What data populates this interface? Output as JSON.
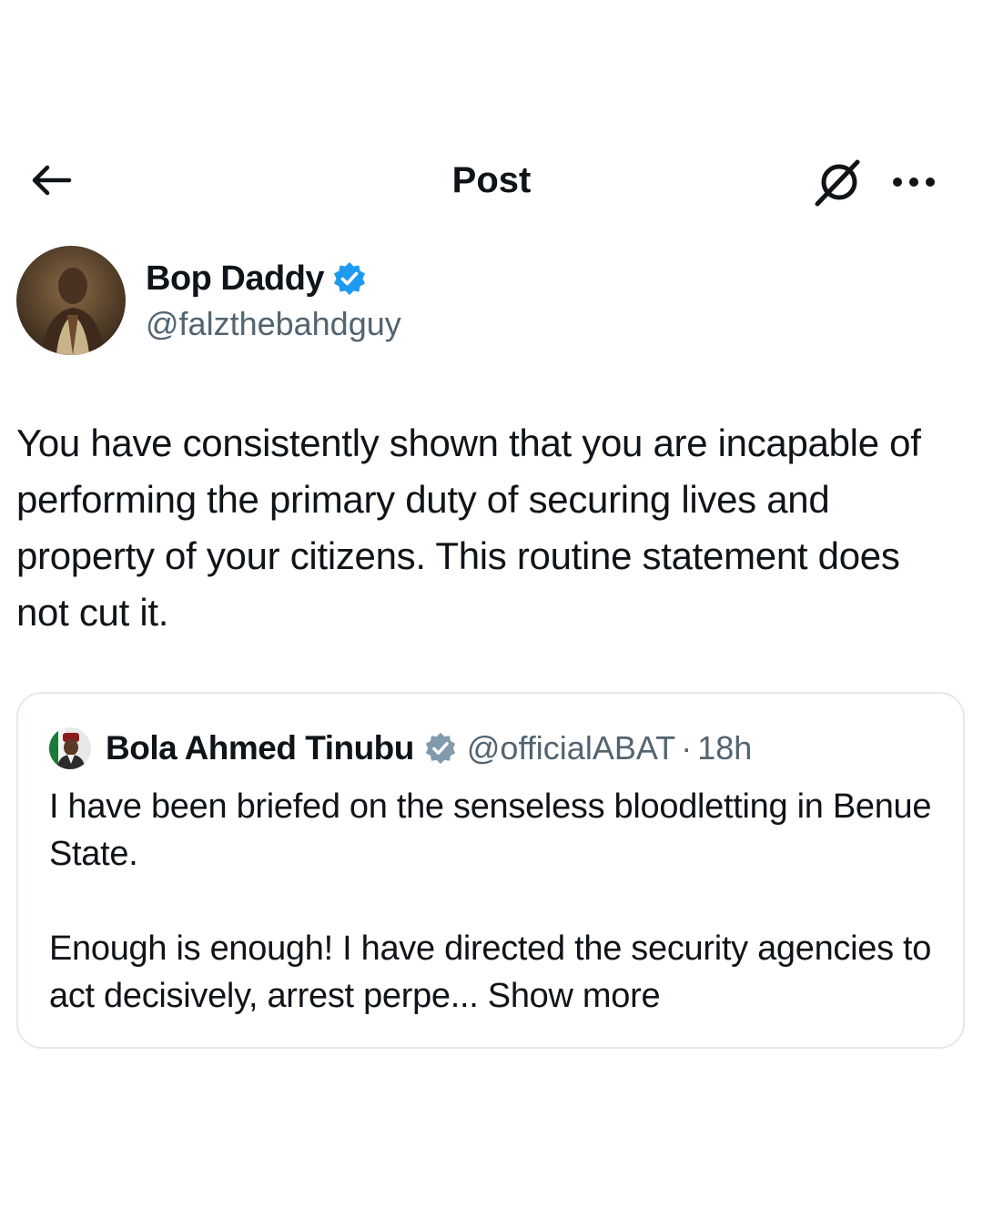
{
  "header": {
    "title": "Post",
    "back_icon": "arrow-left-icon",
    "grok_icon": "grok-icon",
    "more_icon": "more-horizontal-icon"
  },
  "post": {
    "author": {
      "name": "Bop Daddy",
      "handle": "@falzthebahdguy",
      "verified": true,
      "verified_color": "#1d9bf0"
    },
    "text": "You have consistently shown that you are incapable of performing the primary duty of securing lives and property of your citizens. This routine statement does not cut it."
  },
  "quote": {
    "author": {
      "name": "Bola Ahmed Tinubu",
      "handle": "@officialABAT",
      "verified": true,
      "verified_color": "#829aab"
    },
    "separator": "·",
    "time": "18h",
    "paragraph1": "I have been briefed on the senseless bloodletting in Benue State.",
    "paragraph2": "Enough is enough! I have directed the security agencies to act decisively, arrest perpe...",
    "show_more": "Show more"
  },
  "colors": {
    "text_primary": "#0f1419",
    "text_secondary": "#536471",
    "border": "#e4e8ec"
  }
}
